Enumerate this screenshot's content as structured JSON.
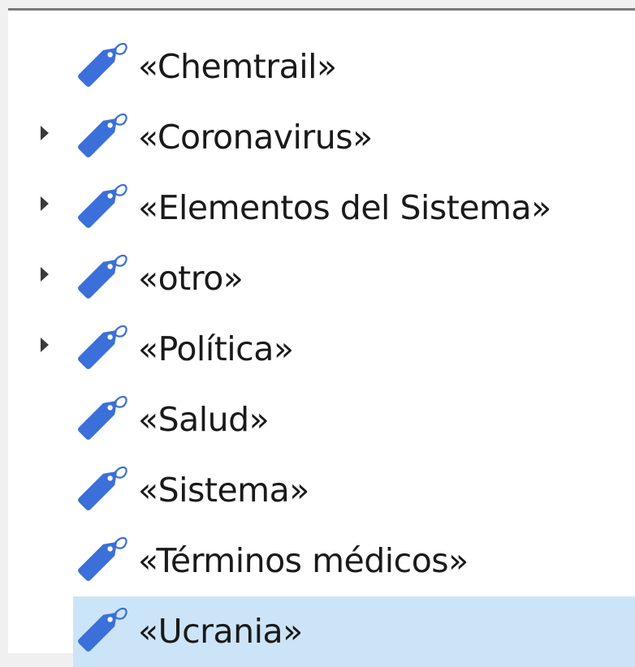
{
  "tree": {
    "items": [
      {
        "label": "«Chemtrail»",
        "expandable": false,
        "selected": false
      },
      {
        "label": "«Coronavirus»",
        "expandable": true,
        "selected": false
      },
      {
        "label": "«Elementos del Sistema»",
        "expandable": true,
        "selected": false
      },
      {
        "label": "«otro»",
        "expandable": true,
        "selected": false
      },
      {
        "label": "«Política»",
        "expandable": true,
        "selected": false
      },
      {
        "label": "«Salud»",
        "expandable": false,
        "selected": false
      },
      {
        "label": "«Sistema»",
        "expandable": false,
        "selected": false
      },
      {
        "label": "«Términos médicos»",
        "expandable": false,
        "selected": false
      },
      {
        "label": "«Ucrania»",
        "expandable": false,
        "selected": true
      }
    ]
  },
  "colors": {
    "tag_icon": "#3b6fd9",
    "selection": "#cce4f7",
    "expander": "#3a3a3a",
    "text": "#1a1a1a"
  },
  "icons": {
    "item_icon": "tag-icon",
    "expander_icon": "expand-arrow-icon"
  }
}
